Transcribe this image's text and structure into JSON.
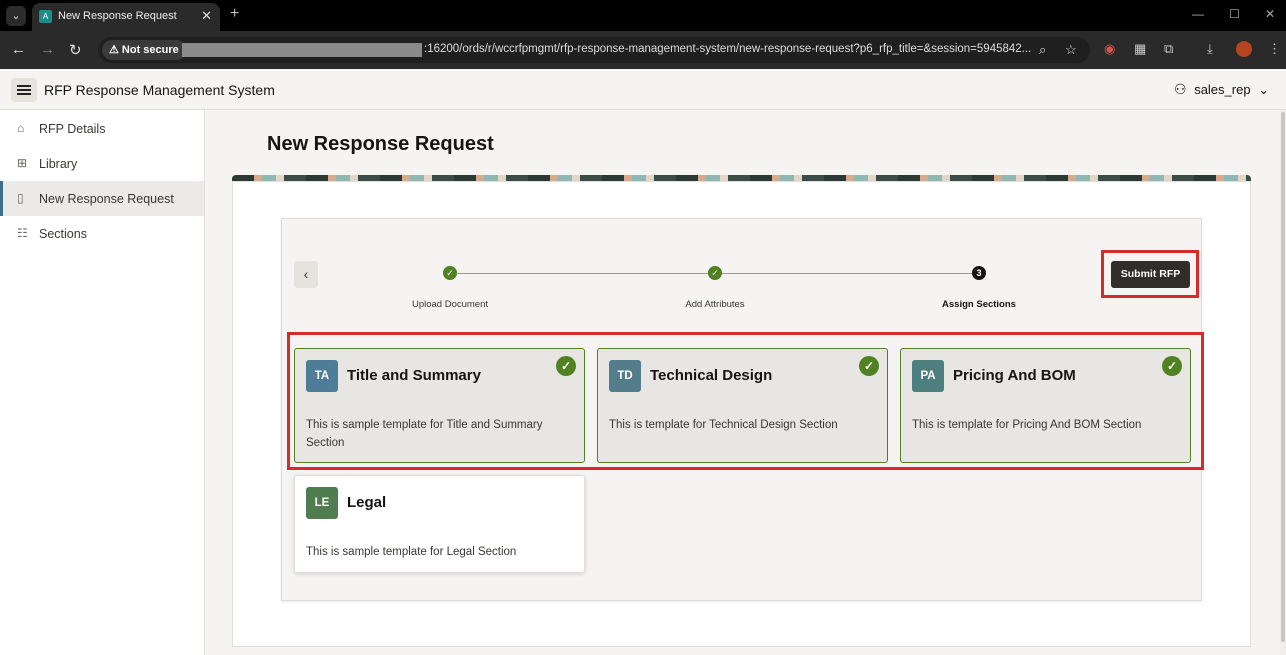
{
  "browser": {
    "tab_title": "New Response Request",
    "tab_favicon": "A",
    "security_label": "Not secure",
    "url_visible": ":16200/ords/r/wccrfpmgmt/rfp-response-management-system/new-response-request?p6_rfp_title=&session=5945842..."
  },
  "header": {
    "app_title": "RFP Response Management System",
    "user": "sales_rep"
  },
  "sidebar": {
    "items": [
      {
        "label": "RFP Details",
        "icon": "home-icon"
      },
      {
        "label": "Library",
        "icon": "grid-icon"
      },
      {
        "label": "New Response Request",
        "icon": "new-doc-icon",
        "active": true
      },
      {
        "label": "Sections",
        "icon": "table-icon"
      }
    ]
  },
  "page": {
    "title": "New Response Request"
  },
  "wizard": {
    "steps": [
      {
        "label": "Upload Document",
        "status": "complete",
        "marker": "✓"
      },
      {
        "label": "Add Attributes",
        "status": "complete",
        "marker": "✓"
      },
      {
        "label": "Assign Sections",
        "status": "current",
        "marker": "3"
      }
    ],
    "previous_label": "‹",
    "submit_label": "Submit RFP"
  },
  "sections": [
    {
      "initials": "TA",
      "title": "Title and Summary",
      "description": "This is sample template for Title and Summary Section",
      "selected": true,
      "badge_color": "#4f7c97"
    },
    {
      "initials": "TD",
      "title": "Technical Design",
      "description": "This is template for Technical Design Section",
      "selected": true,
      "badge_color": "#547d8b"
    },
    {
      "initials": "PA",
      "title": "Pricing And BOM",
      "description": "This is template for Pricing And BOM Section",
      "selected": true,
      "badge_color": "#4e7f80"
    },
    {
      "initials": "LE",
      "title": "Legal",
      "description": "This is sample template for Legal Section",
      "selected": false,
      "badge_color": "#4f7d4f"
    }
  ],
  "colors": {
    "accent": "#3d6e8c",
    "success": "#508223",
    "highlight_border": "#d52b2b",
    "dark_button": "#312d2a"
  }
}
